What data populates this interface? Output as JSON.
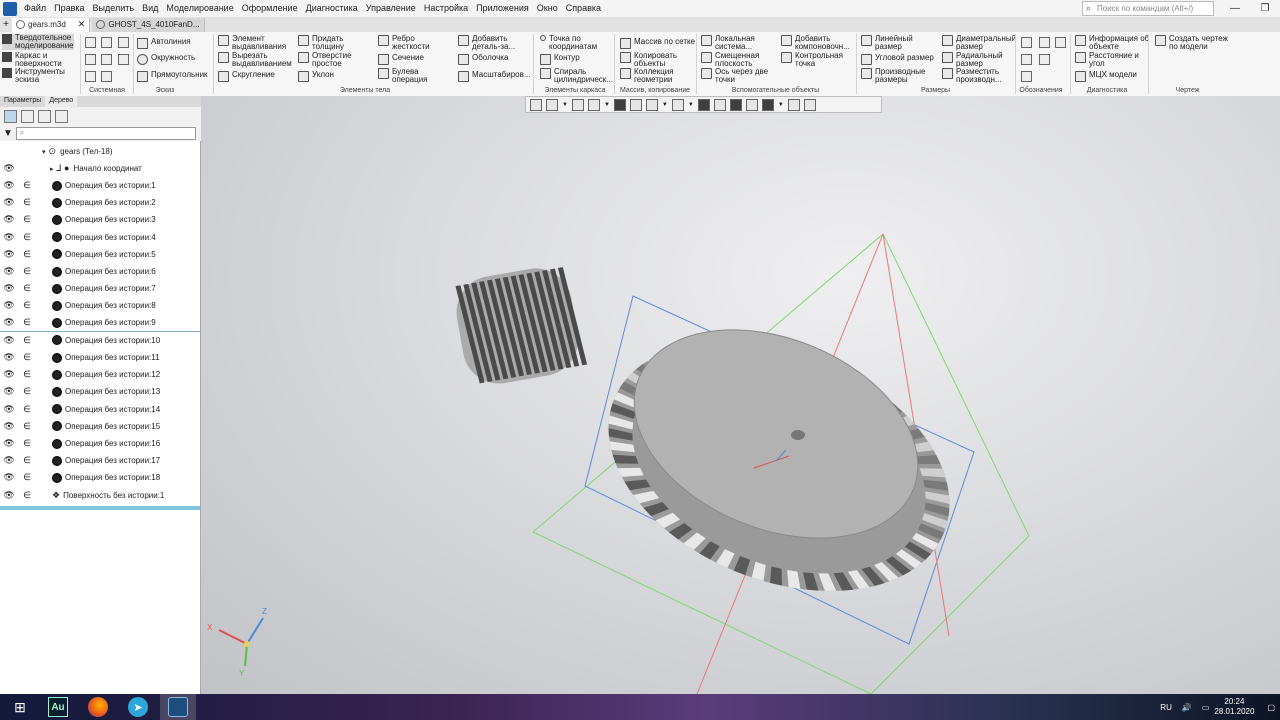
{
  "menubar": {
    "items": [
      "Файл",
      "Правка",
      "Выделить",
      "Вид",
      "Моделирование",
      "Оформление",
      "Диагностика",
      "Управление",
      "Настройка",
      "Приложения",
      "Окно",
      "Справка"
    ],
    "search_placeholder": "Поиск по командам (Alt+/)",
    "minimize": "—",
    "maximize": "❐"
  },
  "tabs": [
    {
      "label": "gears.m3d",
      "close": "✕"
    },
    {
      "label": "GHOST_4S_4010FanD..."
    }
  ],
  "tab_add": "+",
  "ribbon": {
    "modes": [
      {
        "label": "Твердотельное\nмоделирование"
      },
      {
        "label": "Каркас и\nповерхности"
      },
      {
        "label": "Инструменты\nэскиза"
      }
    ],
    "sketch_tools": [
      "Автолиния",
      "Окружность",
      "Прямоугольник"
    ],
    "body_tools": [
      "Элемент\nвыдавливания",
      "Вырезать\nвыдавливанием",
      "Скругление",
      "Придать\nтолщину",
      "Отверстие\nпростое",
      "Уклон",
      "Ребро\nжесткости",
      "Сечение",
      "Булева\nоперация",
      "Добавить\nдеталь-за...",
      "Оболочка",
      "Масштабиров..."
    ],
    "frame_tools": [
      "Точка по\nкоординатам",
      "Контур",
      "Спираль\nцилиндрическ..."
    ],
    "array_tools": [
      "Массив по сетке",
      "Копировать\nобъекты",
      "Коллекция\nгеометрии"
    ],
    "aux_tools": [
      "Локальная\nсистема...",
      "Смещенная\nплоскость",
      "Ось через две\nточки",
      "Добавить\nкомпоновочн...",
      "Контрольная\nточка"
    ],
    "dim_tools": [
      "Линейный\nразмер",
      "Угловой размер",
      "Производные\nразмеры",
      "Диаметральный\nразмер",
      "Радиальный\nразмер",
      "Разместить\nпроизводн..."
    ],
    "diag_tools": [
      "Информация об\nобъекте",
      "Расстояние и\nугол",
      "МЦХ модели"
    ],
    "drawing_tools": [
      "Создать чертеж\nпо модели"
    ],
    "groups": [
      "Системная",
      "Эскиз",
      "Элементы тела",
      "Элементы каркаса",
      "Массив, копирование",
      "Вспомогательные объекты",
      "Размеры",
      "Обозначения",
      "Диагностика",
      "Чертеж"
    ]
  },
  "left_panel": {
    "tabs": [
      "Параметры",
      "Дерево"
    ],
    "filter_placeholder": "⌕",
    "root": "gears (Тел-18)",
    "origin": "Начало координат",
    "operations": [
      "Операция без истории:1",
      "Операция без истории:2",
      "Операция без истории:3",
      "Операция без истории:4",
      "Операция без истории:5",
      "Операция без истории:6",
      "Операция без истории:7",
      "Операция без истории:8",
      "Операция без истории:9",
      "Операция без истории:10",
      "Операция без истории:11",
      "Операция без истории:12",
      "Операция без истории:13",
      "Операция без истории:14",
      "Операция без истории:15",
      "Операция без истории:16",
      "Операция без истории:17",
      "Операция без истории:18"
    ],
    "surface": "Поверхность без истории:1"
  },
  "axes": {
    "x": "X",
    "y": "Y",
    "z": "Z"
  },
  "colors": {
    "accent": "#7fc7dc",
    "x_axis": "#e05050",
    "y_axis": "#55c040",
    "z_axis": "#4a8ad8"
  },
  "taskbar": {
    "au_label": "Au",
    "language": "RU",
    "time": "20:24",
    "date": "28.01.2020"
  }
}
